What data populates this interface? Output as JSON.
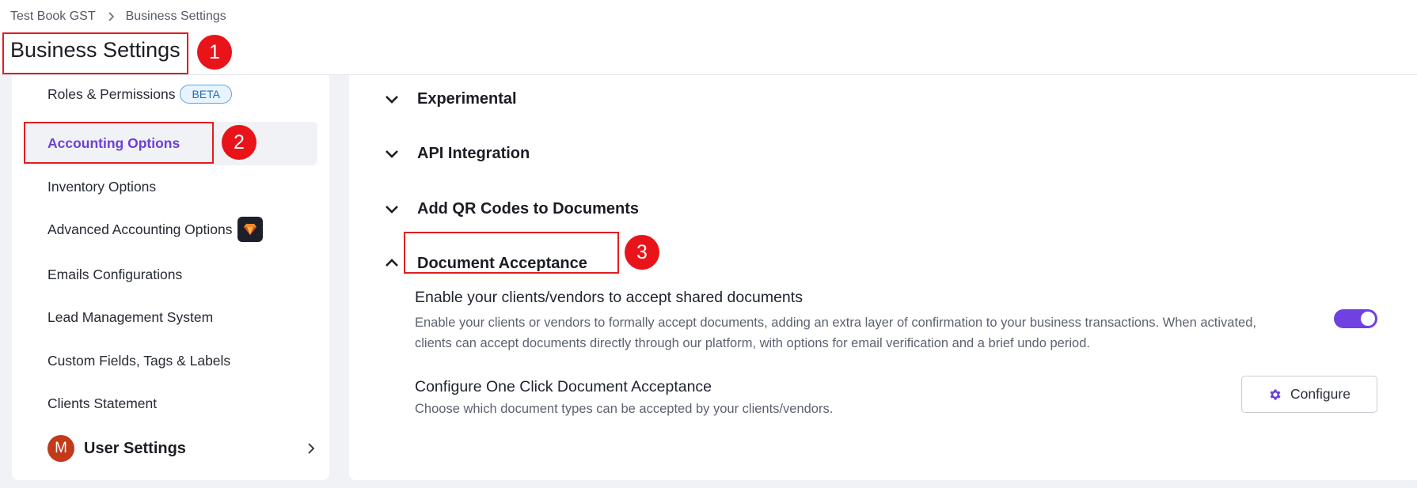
{
  "breadcrumb": {
    "items": [
      "Test Book GST",
      "Business Settings"
    ]
  },
  "page_title": "Business Settings",
  "markers": [
    "1",
    "2",
    "3"
  ],
  "sidebar": {
    "items": [
      {
        "label": "Roles & Permissions",
        "badge": "BETA"
      },
      {
        "label": "Accounting Options",
        "active": true
      },
      {
        "label": "Inventory Options"
      },
      {
        "label": "Advanced Accounting Options",
        "badge_icon": "gem-icon"
      },
      {
        "label": "Emails Configurations"
      },
      {
        "label": "Lead Management System"
      },
      {
        "label": "Custom Fields, Tags & Labels"
      },
      {
        "label": "Clients Statement"
      }
    ],
    "user_settings": {
      "avatar_initial": "M",
      "label": "User Settings"
    }
  },
  "main": {
    "sections": [
      {
        "title": "Experimental",
        "expanded": false
      },
      {
        "title": "API Integration",
        "expanded": false
      },
      {
        "title": "Add QR Codes to Documents",
        "expanded": false
      },
      {
        "title": "Document Acceptance",
        "expanded": true
      }
    ],
    "settings": [
      {
        "title": "Enable your clients/vendors to accept shared documents",
        "description": "Enable your clients or vendors to formally accept documents, adding an extra layer of confirmation to your business transactions. When activated, clients can accept documents directly through our platform, with options for email verification and a brief undo period.",
        "toggle_on": true
      },
      {
        "title": "Configure One Click Document Acceptance",
        "description": "Choose which document types can be accepted by your clients/vendors.",
        "button_label": "Configure"
      }
    ]
  },
  "colors": {
    "accent": "#7041e0",
    "marker_red": "#e8141a",
    "beta_blue": "#1e6fb7"
  }
}
